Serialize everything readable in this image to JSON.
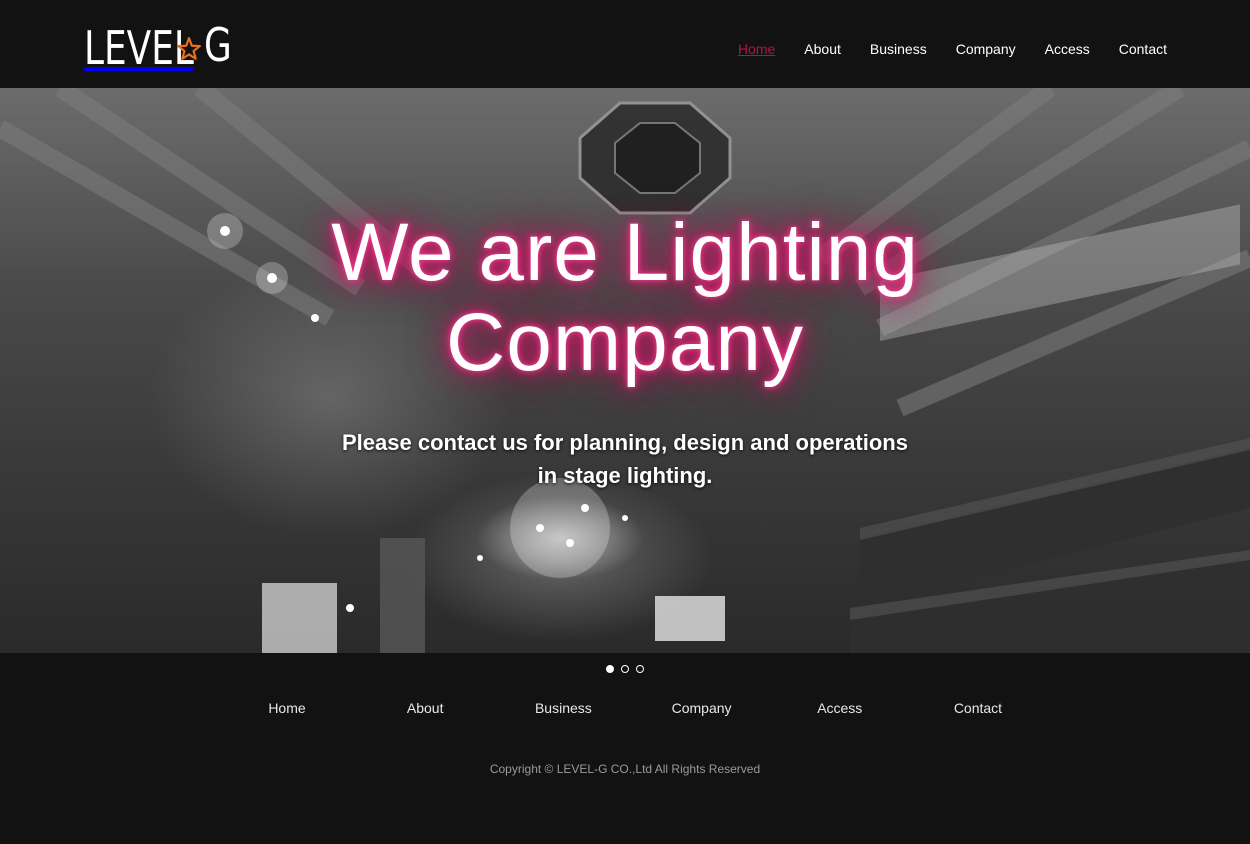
{
  "brand": {
    "logo_text": "LEVEL",
    "logo_letter": "G",
    "star_color": "#e8711c"
  },
  "nav": {
    "items": [
      {
        "label": "Home",
        "active": true
      },
      {
        "label": "About"
      },
      {
        "label": "Business"
      },
      {
        "label": "Company"
      },
      {
        "label": "Access"
      },
      {
        "label": "Contact"
      }
    ],
    "active_color": "#b0124f"
  },
  "hero": {
    "title_line1": "We are Lighting",
    "title_line2": "Company",
    "subtitle_line1": "Please contact us for planning, design and operations",
    "subtitle_line2": "in stage lighting.",
    "glow_color": "#e0196e",
    "slides": 3,
    "active_slide": 1
  },
  "footer": {
    "links": [
      {
        "label": "Home"
      },
      {
        "label": "About"
      },
      {
        "label": "Business"
      },
      {
        "label": "Company"
      },
      {
        "label": "Access"
      },
      {
        "label": "Contact"
      }
    ],
    "copyright": "Copyright © LEVEL-G CO.,Ltd All Rights Reserved"
  }
}
